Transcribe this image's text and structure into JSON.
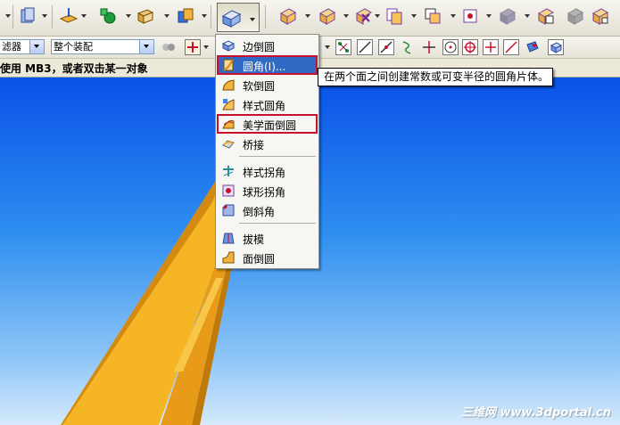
{
  "filter_bar": {
    "filter_label": "滤器",
    "assembly_select_value": "整个装配"
  },
  "cue_line": {
    "text": "使用 MB3，或者双击某一对象"
  },
  "dropdown_menu": {
    "items": [
      {
        "label": "边倒圆",
        "icon": "edge-blend-icon"
      },
      {
        "label": "圆角(I)...",
        "icon": "face-blend-icon"
      },
      {
        "label": "软倒圆",
        "icon": "soft-blend-icon"
      },
      {
        "label": "样式圆角",
        "icon": "styled-blend-icon"
      },
      {
        "label": "美学面倒圆",
        "icon": "aesthetic-face-blend-icon"
      },
      {
        "label": "桥接",
        "icon": "bridge-icon"
      },
      {
        "label": "样式拐角",
        "icon": "styled-corner-icon"
      },
      {
        "label": "球形拐角",
        "icon": "spherical-corner-icon"
      },
      {
        "label": "倒斜角",
        "icon": "chamfer-icon"
      },
      {
        "label": "拔模",
        "icon": "draft-icon"
      },
      {
        "label": "面倒圆",
        "icon": "face-blend-2-icon"
      }
    ]
  },
  "tooltip": {
    "text": "在两个面之间创建常数或可变半径的圆角片体。"
  },
  "watermark": {
    "text": "三维网 www.3dportal.cn"
  },
  "colors": {
    "viewport_top": "#0a52e8",
    "viewport_bottom": "#d5eafb",
    "part_color": "#f0a81c",
    "menu_highlight": "#316ac5",
    "annotation_box": "#c8102e"
  }
}
